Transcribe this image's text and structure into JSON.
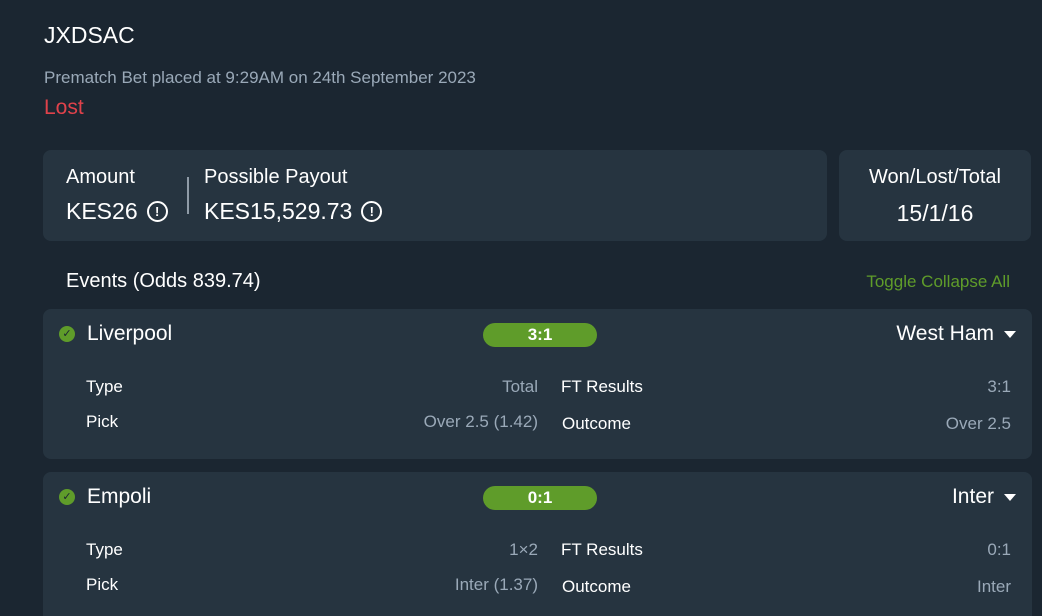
{
  "bet": {
    "id": "JXDSAC",
    "placed": "Prematch Bet placed at 9:29AM on 24th September 2023",
    "status": "Lost"
  },
  "summary": {
    "amount_label": "Amount",
    "amount_value": "KES26",
    "payout_label": "Possible Payout",
    "payout_value": "KES15,529.73",
    "info_glyph": "!",
    "wlt_label": "Won/Lost/Total",
    "wlt_value": "15/1/16"
  },
  "events_section": {
    "title": "Events (Odds 839.74)",
    "toggle_label": "Toggle Collapse All"
  },
  "events": [
    {
      "home": "Liverpool",
      "score": "3:1",
      "away": "West Ham",
      "type_label": "Type",
      "type_value": "Total",
      "pick_label": "Pick",
      "pick_value": "Over 2.5 (1.42)",
      "ft_label": "FT Results",
      "ft_value": "3:1",
      "outcome_label": "Outcome",
      "outcome_value": "Over 2.5"
    },
    {
      "home": "Empoli",
      "score": "0:1",
      "away": "Inter",
      "type_label": "Type",
      "type_value": "1×2",
      "pick_label": "Pick",
      "pick_value": "Inter (1.37)",
      "ft_label": "FT Results",
      "ft_value": "0:1",
      "outcome_label": "Outcome",
      "outcome_value": "Inter"
    }
  ],
  "colors": {
    "background": "#1b2631",
    "card": "#263440",
    "accent_green": "#5f9c2a",
    "lost_red": "#e0424b",
    "muted_text": "#9aa9b8"
  },
  "icons": {
    "info": "info-circle-icon",
    "check": "check-circle-icon",
    "expand": "caret-down-icon"
  }
}
